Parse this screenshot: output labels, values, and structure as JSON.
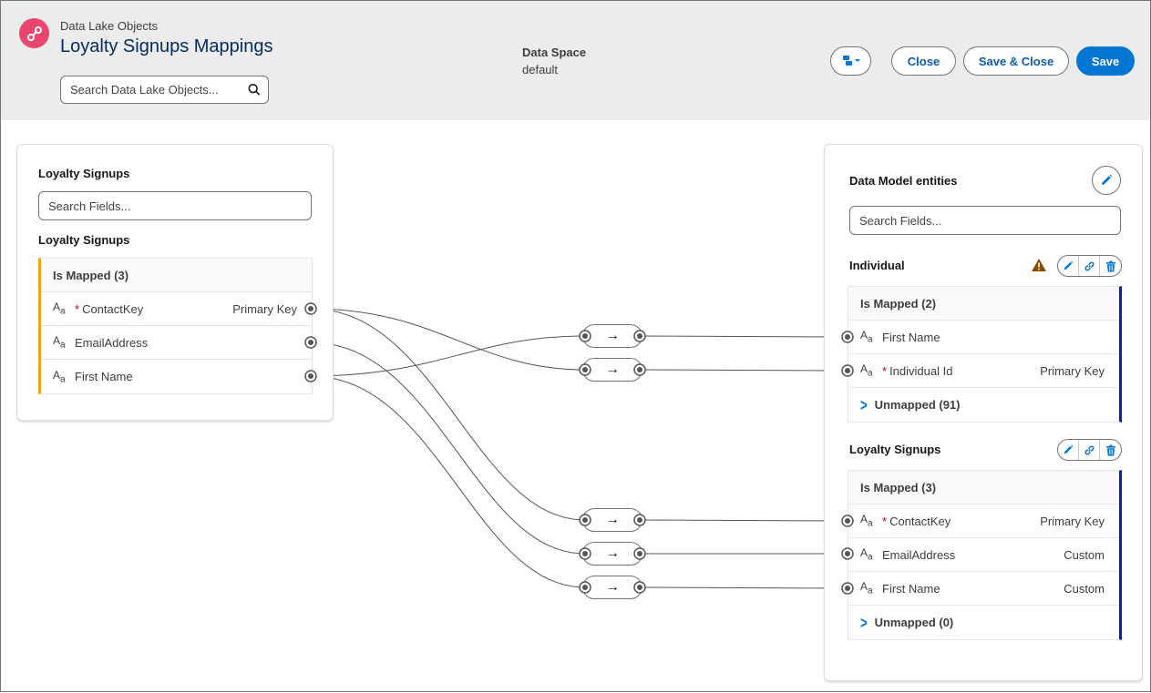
{
  "header": {
    "eyebrow": "Data Lake Objects",
    "title": "Loyalty Signups Mappings",
    "search_placeholder": "Search Data Lake Objects...",
    "data_space_label": "Data Space",
    "data_space_value": "default",
    "buttons": {
      "close": "Close",
      "save_close": "Save & Close",
      "save": "Save"
    }
  },
  "source": {
    "panel_title": "Loyalty Signups",
    "search_placeholder": "Search Fields...",
    "object_title": "Loyalty Signups",
    "mapped_header": "Is Mapped (3)",
    "fields": [
      {
        "name": "ContactKey",
        "required": true,
        "tag": "Primary Key"
      },
      {
        "name": "EmailAddress",
        "required": false,
        "tag": ""
      },
      {
        "name": "First Name",
        "required": false,
        "tag": ""
      }
    ]
  },
  "target": {
    "panel_title": "Data Model entities",
    "search_placeholder": "Search Fields...",
    "entities": [
      {
        "name": "Individual",
        "has_warning": true,
        "mapped_header": "Is Mapped (2)",
        "fields": [
          {
            "name": "First Name",
            "required": false,
            "tag": ""
          },
          {
            "name": "Individual Id",
            "required": true,
            "tag": "Primary Key"
          }
        ],
        "unmapped": "Unmapped (91)"
      },
      {
        "name": "Loyalty Signups",
        "has_warning": false,
        "mapped_header": "Is Mapped (3)",
        "fields": [
          {
            "name": "ContactKey",
            "required": true,
            "tag": "Primary Key"
          },
          {
            "name": "EmailAddress",
            "required": false,
            "tag": "Custom"
          },
          {
            "name": "First Name",
            "required": false,
            "tag": "Custom"
          }
        ],
        "unmapped": "Unmapped (0)"
      }
    ]
  },
  "mappings": [
    {
      "source": "ContactKey",
      "target": "Individual.Individual Id"
    },
    {
      "source": "First Name",
      "target": "Individual.First Name"
    },
    {
      "source": "ContactKey",
      "target": "Loyalty Signups.ContactKey"
    },
    {
      "source": "EmailAddress",
      "target": "Loyalty Signups.EmailAddress"
    },
    {
      "source": "First Name",
      "target": "Loyalty Signups.First Name"
    }
  ],
  "colors": {
    "brand": "#0176d3",
    "source_accent": "#f4a51c",
    "target_accent": "#1a237e",
    "app_icon": "#e9466d",
    "warning": "#8c4b02"
  },
  "icons": {
    "app": "data-lake-link-icon",
    "search": "search-icon",
    "transform": "arrow-right-icon",
    "edit": "pencil-icon",
    "link": "link-icon",
    "delete": "trash-icon",
    "warning": "warning-icon",
    "expand": "chevron-right-icon",
    "text_field": "text-type-icon"
  }
}
